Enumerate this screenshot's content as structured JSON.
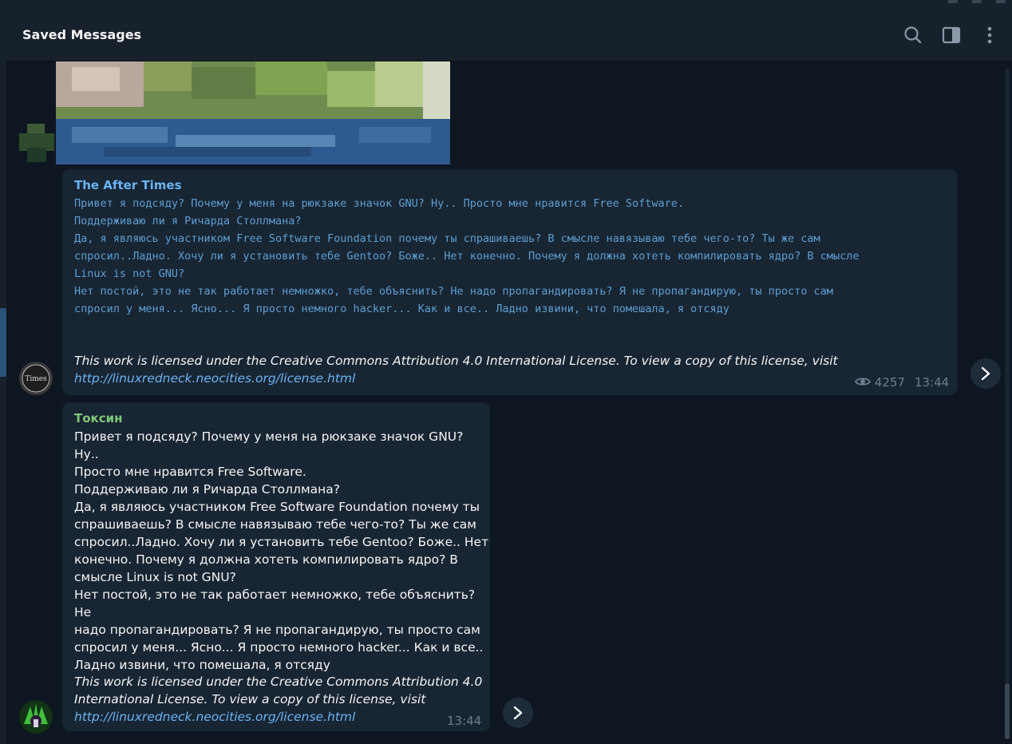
{
  "header": {
    "title": "Saved Messages"
  },
  "messages": [
    {
      "sender": "The After Times",
      "sender_color": "#6ab3f3",
      "code_lines": "Привет я подсяду? Почему у меня на рюкзаке значок GNU? Ну.. Просто мне нравится Free Software.\nПоддерживаю ли я Ричарда Столлмана?\nДа, я являюсь участником Free Software Foundation почему ты спрашиваешь? В смысле навязываю тебе чего-то? Ты же сам\nспросил..Ладно. Хочу ли я установить тебе Gentoo? Боже.. Нет конечно. Почему я должна хотеть компилировать ядро? В смысле\nLinux is not GNU?\nНет постой, это не так работает немножко, тебе объяснить? Не надо пропагандировать? Я не пропагандирую, ты просто сам\nспросил у меня... Ясно... Я просто немного hacker... Как и все.. Ладно извини, что помешала, я отсяду",
      "license_text": "This work is licensed under the Creative Commons Attribution 4.0 International License. To view a copy of this license, visit",
      "license_link": "http://linuxredneck.neocities.org/license.html",
      "views": "4257",
      "time": "13:44"
    },
    {
      "sender": "Токсин",
      "sender_color": "#7ec87a",
      "body": "Привет я подсяду? Почему у меня на рюкзаке значок GNU? Ну..\nПросто мне нравится Free Software.\nПоддерживаю ли я Ричарда Столлмана?\nДа, я являюсь участником Free Software Foundation почему ты\nспрашиваешь? В смысле навязываю тебе чего-то? Ты же сам\nспросил..Ладно. Хочу ли я установить тебе Gentoo? Боже.. Нет\nконечно. Почему я должна хотеть компилировать ядро? В\nсмысле Linux is not GNU?\nНет постой, это не так работает немножко, тебе объяснить? Не\nнадо пропагандировать? Я не пропагандирую, ты просто сам\nспросил у меня... Ясно... Я просто немного hacker... Как и все..\nЛадно извини, что помешала, я отсяду",
      "license_text": "This work is licensed under the Creative Commons Attribution 4.0\nInternational License. To view a copy of this license, visit",
      "license_link": "http://linuxredneck.neocities.org/license.html",
      "time": "13:44"
    }
  ],
  "colors": {
    "background": "#0e1621",
    "bubble": "#182533",
    "header": "#17212b",
    "link": "#6ab3f3",
    "meta": "#6d7f8f"
  },
  "icons": {
    "search": "search-icon",
    "sidebar": "sidebar-toggle-icon",
    "more": "more-vertical-icon",
    "views": "eye-icon",
    "forward": "forward-arrow-icon"
  }
}
